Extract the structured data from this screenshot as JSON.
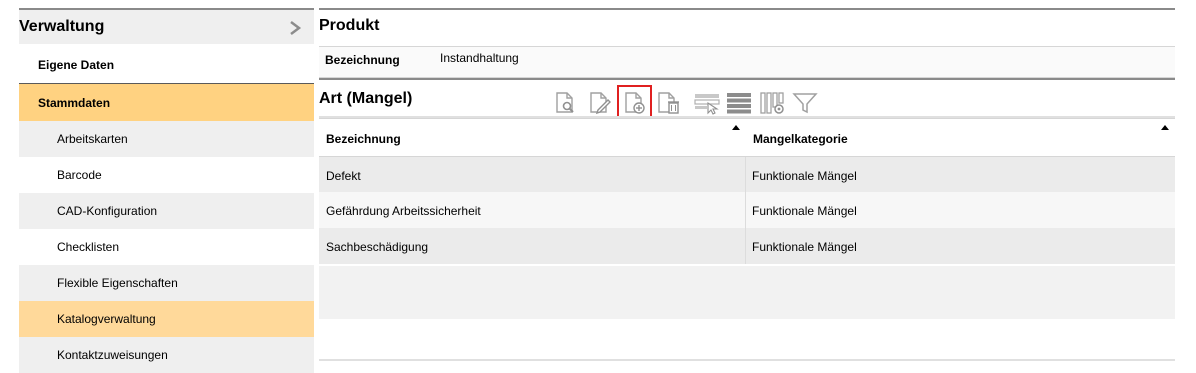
{
  "sidebar": {
    "title": "Verwaltung",
    "items": [
      {
        "label": "Eigene Daten"
      },
      {
        "label": "Stammdaten"
      },
      {
        "label": "Arbeitskarten"
      },
      {
        "label": "Barcode"
      },
      {
        "label": "CAD-Konfiguration"
      },
      {
        "label": "Checklisten"
      },
      {
        "label": "Flexible Eigenschaften"
      },
      {
        "label": "Katalogverwaltung"
      },
      {
        "label": "Kontaktzuweisungen"
      }
    ],
    "selected_color": "#ffd281",
    "highlight_color": "#ffd99a"
  },
  "product": {
    "title": "Produkt",
    "field_label": "Bezeichnung",
    "field_value": "Instandhaltung"
  },
  "art": {
    "title": "Art (Mangel)",
    "toolbar_icons": [
      "view-document-icon",
      "edit-document-icon",
      "add-document-icon",
      "delete-document-icon",
      "select-row-icon",
      "list-view-icon",
      "column-settings-icon",
      "filter-icon"
    ],
    "highlight_border_color": "#e02020"
  },
  "table": {
    "columns": [
      "Bezeichnung",
      "Mangelkategorie"
    ],
    "rows": [
      [
        "Defekt",
        "Funktionale Mängel"
      ],
      [
        "Gefährdung Arbeitssicherheit",
        "Funktionale Mängel"
      ],
      [
        "Sachbeschädigung",
        "Funktionale Mängel"
      ]
    ]
  }
}
